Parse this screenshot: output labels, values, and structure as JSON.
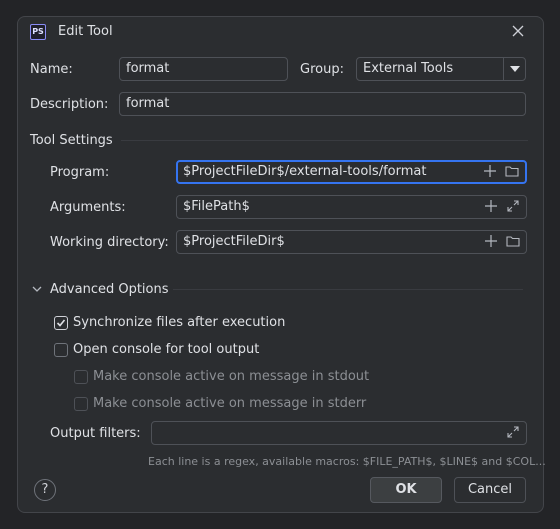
{
  "dialog": {
    "title": "Edit Tool",
    "logo_text": "PS",
    "close_icon": "close-icon"
  },
  "form": {
    "name_label": "Name:",
    "name_value": "format",
    "group_label": "Group:",
    "group_value": "External Tools",
    "description_label": "Description:",
    "description_value": "format"
  },
  "tool_settings": {
    "title": "Tool Settings",
    "program_label": "Program:",
    "program_value": "$ProjectFileDir$/external-tools/format",
    "arguments_label": "Arguments:",
    "arguments_value": "$FilePath$",
    "workdir_label": "Working directory:",
    "workdir_value": "$ProjectFileDir$"
  },
  "advanced": {
    "title": "Advanced Options",
    "sync_label": "Synchronize files after execution",
    "sync_checked": true,
    "console_label": "Open console for tool output",
    "console_checked": false,
    "stdout_label": "Make console active on message in stdout",
    "stderr_label": "Make console active on message in stderr",
    "output_filters_label": "Output filters:",
    "output_filters_value": "",
    "hint": "Each line is a regex, available macros: $FILE_PATH$, $LINE$ and $COL..."
  },
  "footer": {
    "help_label": "?",
    "ok_label": "OK",
    "cancel_label": "Cancel"
  },
  "colors": {
    "accent": "#3574F0",
    "background": "#2B2D30",
    "text": "#DFE1E5"
  }
}
